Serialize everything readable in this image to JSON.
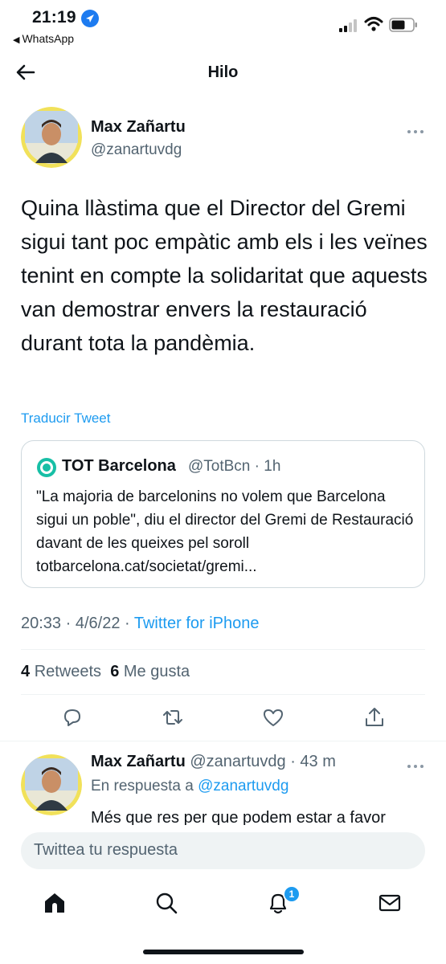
{
  "status_bar": {
    "time": "21:19",
    "back_app": "WhatsApp"
  },
  "nav": {
    "title": "Hilo"
  },
  "tweet": {
    "author_name": "Max Zañartu",
    "author_handle": "@zanartuvdg",
    "text": "Quina llàstima que el Director del Gremi sigui tant poc empàtic amb els i les veïnes tenint en compte la solidaritat que aquests van demostrar envers la restauració durant tota la pandèmia.",
    "translate_label": "Traducir Tweet",
    "time": "20:33",
    "date": "4/6/22",
    "source": "Twitter for iPhone",
    "retweets_count": "4",
    "retweets_label": "Retweets",
    "likes_count": "6",
    "likes_label": "Me gusta"
  },
  "quote": {
    "name": "TOT Barcelona",
    "handle": "@TotBcn",
    "age": "1h",
    "text": "\"La majoria de barcelonins no volem que Barcelona sigui un poble\", diu el director del Gremi de Restauració davant de les queixes pel soroll totbarcelona.cat/societat/gremi..."
  },
  "reply": {
    "author_name": "Max Zañartu",
    "author_handle": "@zanartuvdg",
    "age": "43 m",
    "in_reply_prefix": "En respuesta a",
    "in_reply_handle": "@zanartuvdg",
    "text": "Més que res per que podem estar a favor"
  },
  "compose": {
    "placeholder": "Twittea tu respuesta"
  },
  "tabbar": {
    "notification_badge": "1"
  },
  "colors": {
    "accent": "#1d9bf0",
    "text_primary": "#0f1419",
    "text_secondary": "#536471",
    "border": "#cfd9de",
    "quote_logo": "#17bfa6"
  },
  "icons": {
    "location": "location-arrow-icon",
    "signal": "cellular-signal-icon",
    "wifi": "wifi-icon",
    "battery": "battery-icon",
    "back": "back-arrow-icon",
    "more": "more-dots-icon",
    "reply": "reply-icon",
    "retweet": "retweet-icon",
    "like": "heart-icon",
    "share": "share-icon",
    "home": "home-icon",
    "search": "search-icon",
    "notifications": "bell-icon",
    "messages": "envelope-icon"
  }
}
